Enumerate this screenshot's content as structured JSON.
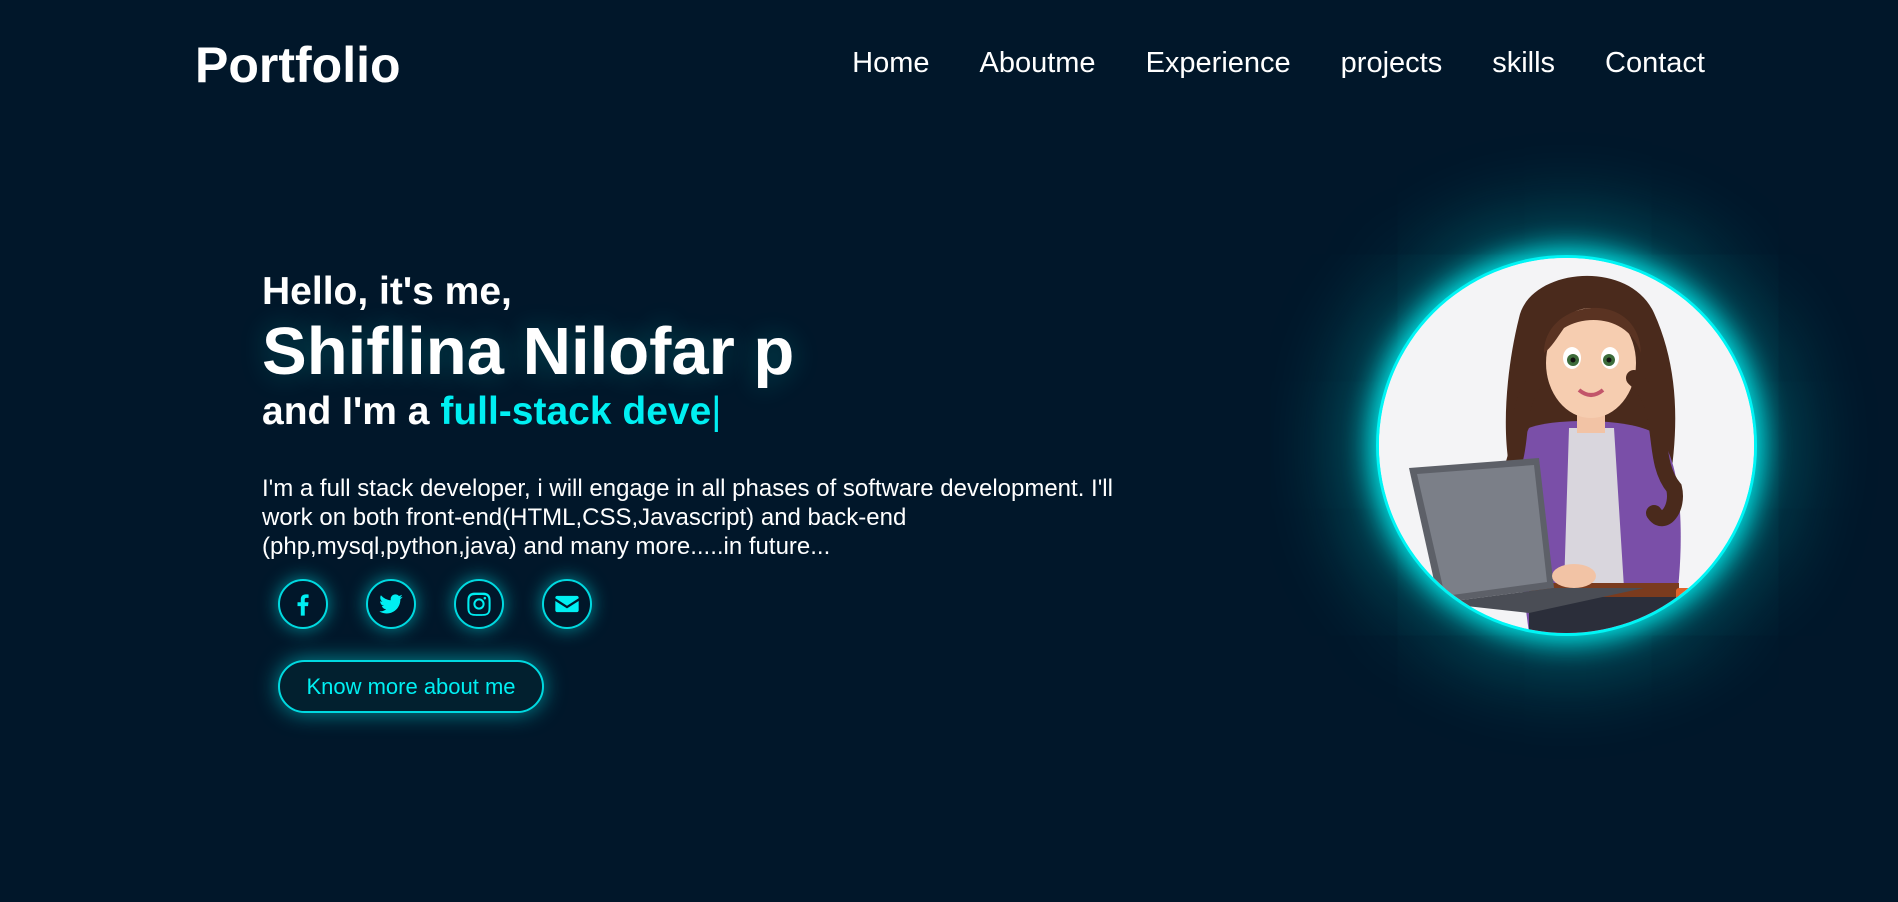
{
  "header": {
    "logo": "Portfolio",
    "nav": [
      "Home",
      "Aboutme",
      "Experience",
      "projects",
      "skills",
      "Contact"
    ]
  },
  "hero": {
    "greeting": "Hello, it's me,",
    "name": "Shiflina Nilofar p",
    "role_prefix": "and I'm a",
    "role_typed": "full-stack deve",
    "caret": "|",
    "description": "I'm a full stack developer, i will engage in all phases of software development. I'll work on both front-end(HTML,CSS,Javascript) and back-end (php,mysql,python,java) and many more.....in future...",
    "socials": [
      "facebook-icon",
      "twitter-icon",
      "instagram-icon",
      "mail-icon"
    ],
    "button_label": "Know more about me"
  },
  "colors": {
    "background": "#01172a",
    "accent": "#00eff2",
    "text": "#ffffff"
  }
}
